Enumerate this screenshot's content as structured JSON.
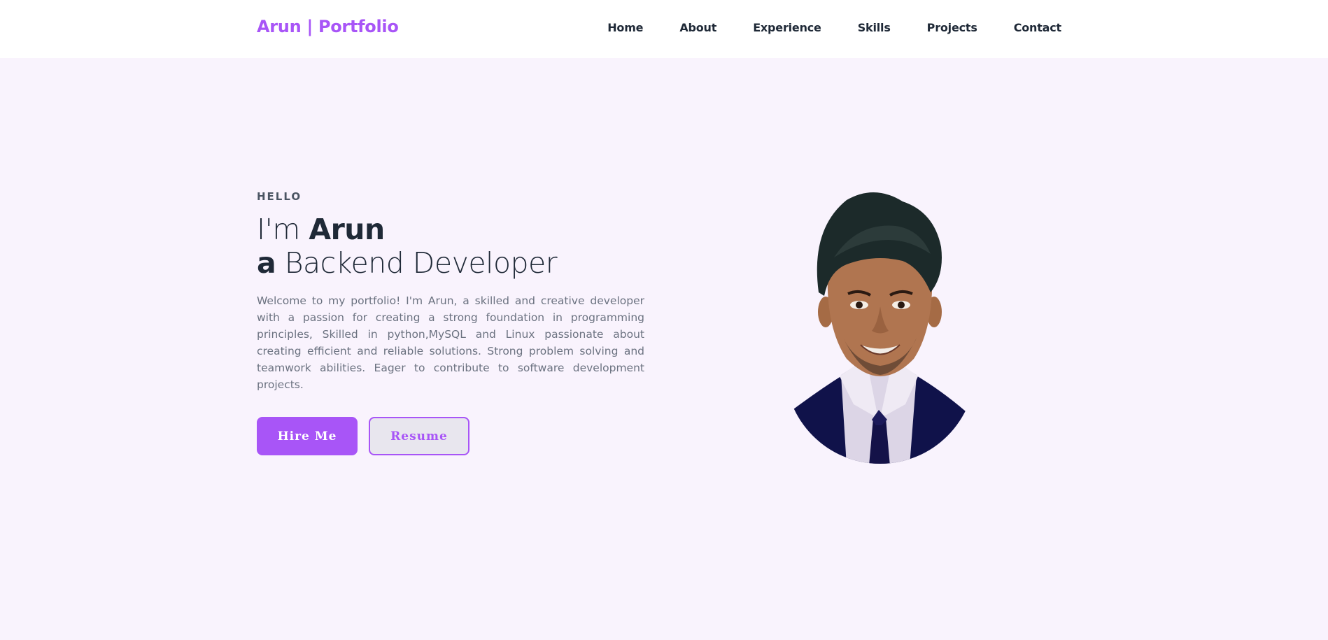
{
  "nav": {
    "brand": "Arun | Portfolio",
    "links": [
      "Home",
      "About",
      "Experience",
      "Skills",
      "Projects",
      "Contact"
    ]
  },
  "hero": {
    "greeting": "HELLO",
    "line1_prefix": "I'm ",
    "line1_name": "Arun",
    "line2_prefix": "a",
    "line2_role": " Backend Developer",
    "intro": "Welcome to my portfolio! I'm Arun, a skilled and creative developer with a passion for creating a strong foundation in programming principles, Skilled in python,MySQL and Linux passionate about creating efficient and reliable solutions. Strong problem solving and teamwork abilities. Eager to contribute to software development projects.",
    "hire_label": "Hire Me",
    "resume_label": "Resume"
  },
  "colors": {
    "accent": "#a855f7",
    "page_bg": "#f9f3fd",
    "heading": "#1f2937",
    "body_text": "#6b7280"
  }
}
